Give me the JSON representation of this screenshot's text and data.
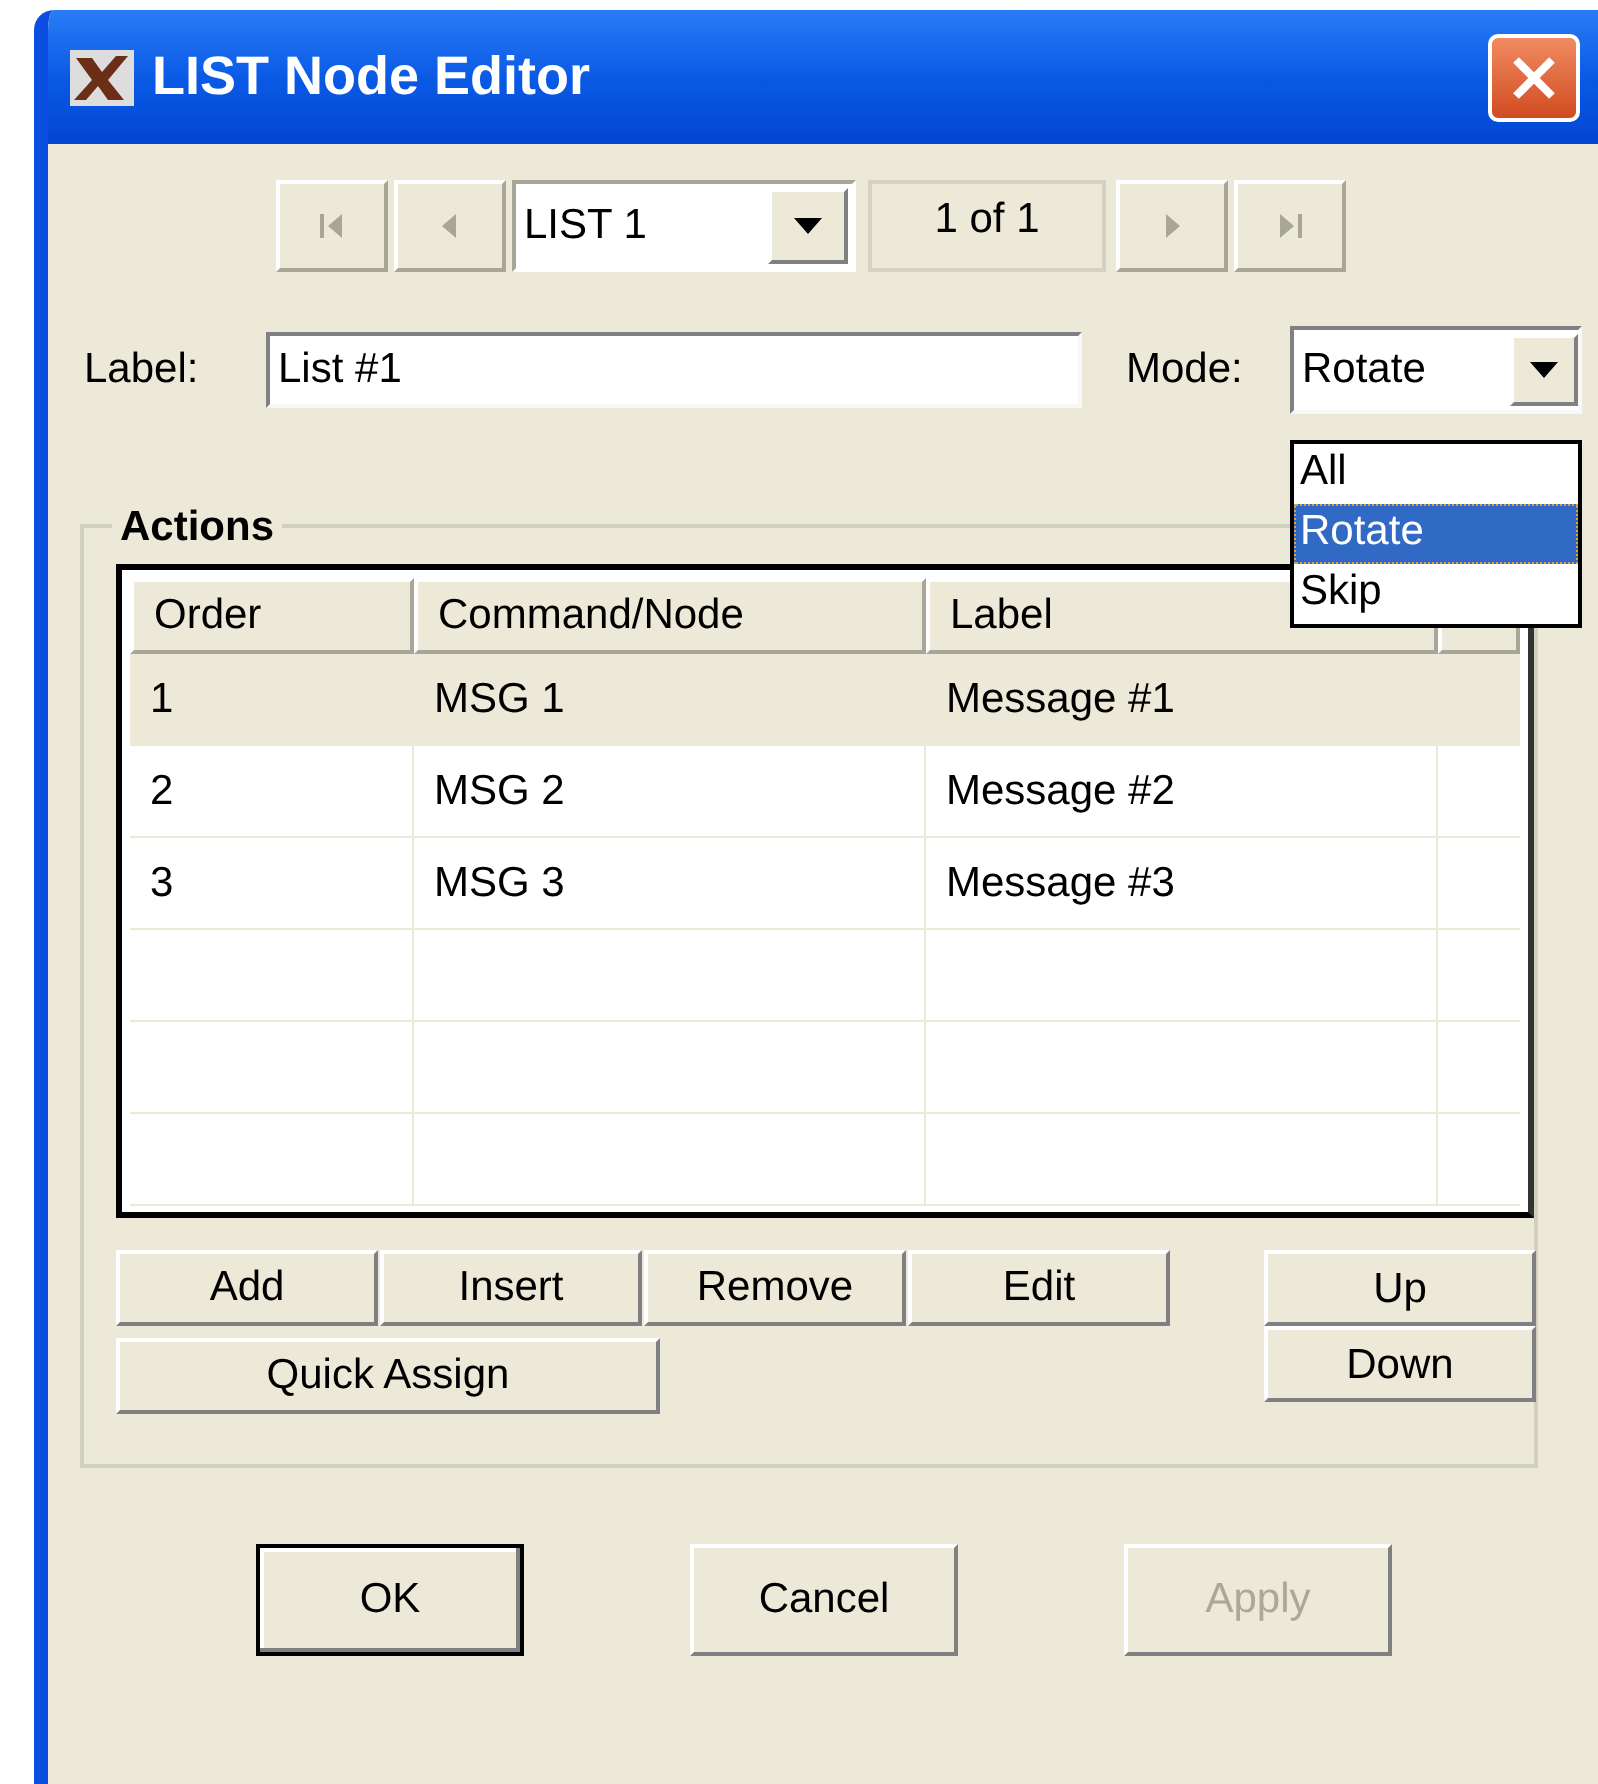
{
  "window": {
    "title": "LIST Node Editor"
  },
  "navigator": {
    "buttons": [
      {
        "kind": "first",
        "disabled": true
      },
      {
        "kind": "previous",
        "disabled": true
      },
      {
        "kind": "next",
        "disabled": true
      },
      {
        "kind": "last",
        "disabled": true
      }
    ],
    "list_select": {
      "value": "LIST 1"
    },
    "counter": "1 of 1"
  },
  "label_field": {
    "label": "Label:",
    "value": "List #1"
  },
  "mode": {
    "label": "Mode:",
    "value": "Rotate",
    "expanded": true,
    "options": [
      {
        "label": "All",
        "selected": false
      },
      {
        "label": "Rotate",
        "selected": true
      },
      {
        "label": "Skip",
        "selected": false
      }
    ]
  },
  "actions": {
    "title": "Actions",
    "columns": [
      "Order",
      "Command/Node",
      "Label"
    ],
    "rows": [
      {
        "cells": [
          "1",
          "MSG 1",
          "Message #1"
        ],
        "selected": true
      },
      {
        "cells": [
          "2",
          "MSG 2",
          "Message #2"
        ],
        "selected": false
      },
      {
        "cells": [
          "3",
          "MSG 3",
          "Message #3"
        ],
        "selected": false
      }
    ],
    "edit_buttons": [
      "Add",
      "Insert",
      "Remove",
      "Edit"
    ],
    "quick_assign": "Quick Assign",
    "move_buttons": [
      "Up",
      "Down"
    ]
  },
  "buttons": [
    {
      "label": "OK",
      "default": true,
      "disabled": false
    },
    {
      "label": "Cancel",
      "default": false,
      "disabled": false
    },
    {
      "label": "Apply",
      "default": false,
      "disabled": true
    }
  ]
}
